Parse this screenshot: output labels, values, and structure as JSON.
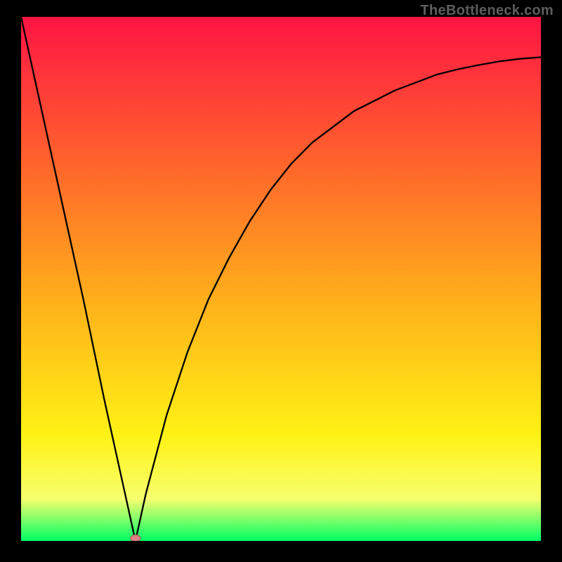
{
  "watermark": "TheBottleneck.com",
  "colors": {
    "bg_black": "#000000",
    "curve": "#000000",
    "marker_fill": "#d98080",
    "marker_stroke": "#a05050",
    "grad_top": "#ff1444",
    "grad_mid1": "#ff6a2a",
    "grad_mid2": "#ffb21a",
    "grad_mid3": "#fff215",
    "grad_band": "#f6ff6e",
    "grad_bottom": "#00ff66"
  },
  "chart_data": {
    "type": "line",
    "title": "",
    "xlabel": "",
    "ylabel": "",
    "ylim": [
      0,
      100
    ],
    "xlim": [
      0,
      100
    ],
    "minimum_x": 22,
    "marker": {
      "x": 22,
      "y": 0.5
    },
    "series": [
      {
        "name": "curve",
        "x": [
          0,
          4,
          8,
          12,
          16,
          20,
          22,
          24,
          28,
          32,
          36,
          40,
          44,
          48,
          52,
          56,
          60,
          64,
          68,
          72,
          76,
          80,
          84,
          88,
          92,
          96,
          100
        ],
        "values": [
          100,
          82,
          64,
          46,
          27,
          9,
          0,
          9,
          24,
          36,
          46,
          54,
          61,
          67,
          72,
          76,
          79,
          82,
          84,
          86,
          87.5,
          89,
          90,
          90.8,
          91.5,
          92,
          92.3
        ]
      }
    ]
  }
}
